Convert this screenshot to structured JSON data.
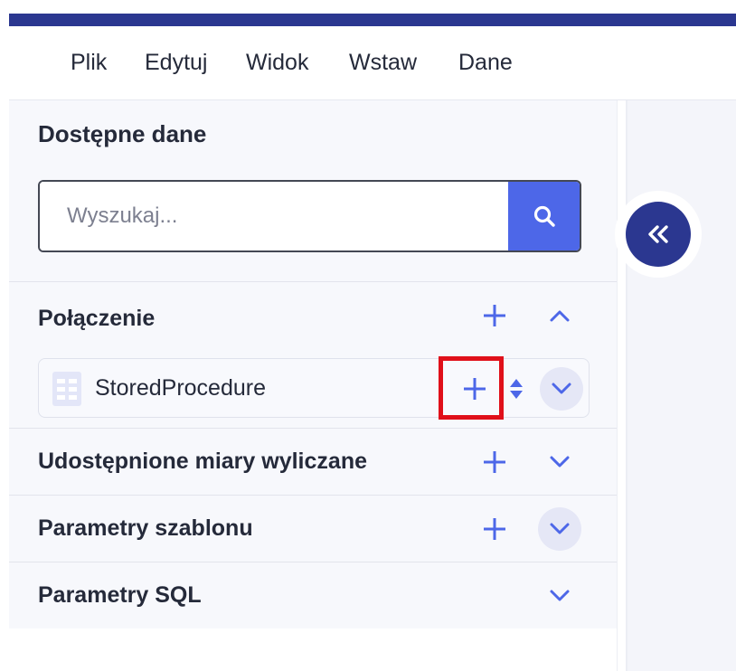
{
  "menu": {
    "items": [
      "Plik",
      "Edytuj",
      "Widok",
      "Wstaw",
      "Dane"
    ]
  },
  "panel": {
    "title": "Dostępne dane",
    "search": {
      "placeholder": "Wyszukaj...",
      "value": "",
      "button_icon": "search-icon"
    },
    "sections": [
      {
        "title": "Połączenie",
        "expanded": true,
        "actions": [
          "plus-icon",
          "chevron-up-icon"
        ],
        "items": [
          {
            "label": "StoredProcedure",
            "icon": "table-icon",
            "actions": [
              "plus-icon",
              "sort-arrows-icon",
              "chevron-down-icon"
            ]
          }
        ]
      },
      {
        "title": "Udostępnione miary wyliczane",
        "expanded": false,
        "actions": [
          "plus-icon",
          "chevron-down-icon"
        ]
      },
      {
        "title": "Parametry szablonu",
        "expanded": false,
        "actions": [
          "plus-icon",
          "chevron-down-icon"
        ]
      },
      {
        "title": "Parametry SQL",
        "expanded": false,
        "actions": [
          "chevron-down-icon"
        ]
      }
    ]
  },
  "collapse_button": {
    "icon": "double-chevron-left-icon"
  },
  "colors": {
    "brand": "#2b3790",
    "accent": "#4d67e8",
    "panel_bg": "#f7f8fc",
    "highlight": "#e0101a",
    "text": "#252a3a"
  }
}
